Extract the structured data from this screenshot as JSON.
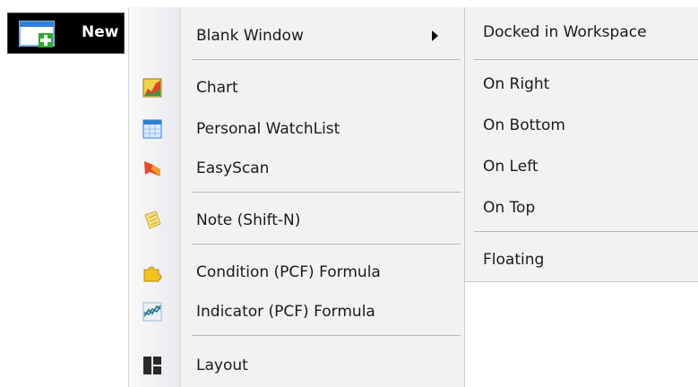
{
  "new_button": {
    "label": "New"
  },
  "menu": {
    "items": [
      {
        "label": "Blank Window",
        "icon": "none",
        "has_submenu": true
      },
      {
        "label": "Chart",
        "icon": "chart-icon"
      },
      {
        "label": "Personal WatchList",
        "icon": "watchlist-icon"
      },
      {
        "label": "EasyScan",
        "icon": "easyscan-icon"
      },
      {
        "label": "Note (Shift-N)",
        "icon": "note-icon"
      },
      {
        "label": "Condition (PCF) Formula",
        "icon": "puzzle-icon"
      },
      {
        "label": "Indicator (PCF) Formula",
        "icon": "indicator-chart-icon"
      },
      {
        "label": "Layout",
        "icon": "layout-icon"
      }
    ]
  },
  "submenu": {
    "items": [
      {
        "label": "Docked in Workspace"
      },
      {
        "label": "On Right"
      },
      {
        "label": "On Bottom"
      },
      {
        "label": "On Left"
      },
      {
        "label": "On Top"
      },
      {
        "label": "Floating"
      }
    ]
  },
  "colors": {
    "menu_bg": "#f2f2f2",
    "button_bg": "#000000",
    "accent_blue": "#2f7fd8",
    "accent_green": "#2fa82f"
  }
}
